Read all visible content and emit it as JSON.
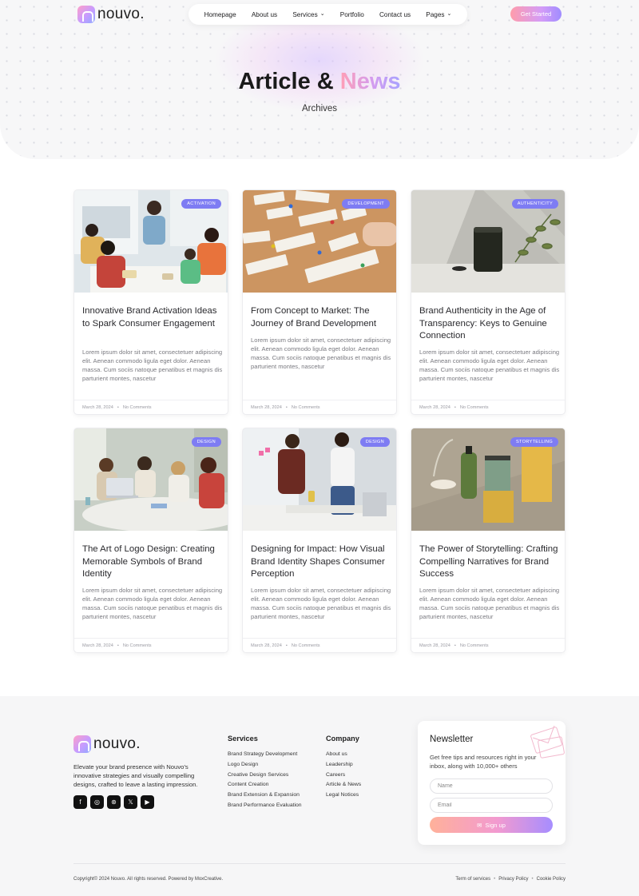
{
  "header": {
    "logo_text": "nouvo.",
    "nav": [
      {
        "label": "Homepage",
        "has_dropdown": false
      },
      {
        "label": "About us",
        "has_dropdown": false
      },
      {
        "label": "Services",
        "has_dropdown": true
      },
      {
        "label": "Portfolio",
        "has_dropdown": false
      },
      {
        "label": "Contact us",
        "has_dropdown": false
      },
      {
        "label": "Pages",
        "has_dropdown": true
      }
    ],
    "cta_label": "Get Started"
  },
  "hero": {
    "title_main": "Article & ",
    "title_accent": "News",
    "subtitle": "Archives"
  },
  "posts": [
    {
      "category": "ACTIVATION",
      "title": "Innovative Brand Activation Ideas to Spark Consumer Engagement",
      "excerpt": "Lorem ipsum dolor sit amet, consectetuer adipiscing elit. Aenean commodo ligula eget dolor. Aenean massa. Cum sociis natoque penatibus et magnis dis parturient montes, nascetur",
      "date": "March 28, 2024",
      "comments": "No Comments"
    },
    {
      "category": "DEVELOPMENT",
      "title": "From Concept to Market: The Journey of Brand Development",
      "excerpt": "Lorem ipsum dolor sit amet, consectetuer adipiscing elit. Aenean commodo ligula eget dolor. Aenean massa. Cum sociis natoque penatibus et magnis dis parturient montes, nascetur",
      "date": "March 28, 2024",
      "comments": "No Comments"
    },
    {
      "category": "AUTHENTICITY",
      "title": "Brand Authenticity in the Age of Transparency: Keys to Genuine Connection",
      "excerpt": "Lorem ipsum dolor sit amet, consectetuer adipiscing elit. Aenean commodo ligula eget dolor. Aenean massa. Cum sociis natoque penatibus et magnis dis parturient montes, nascetur",
      "date": "March 28, 2024",
      "comments": "No Comments"
    },
    {
      "category": "DESIGN",
      "title": "The Art of Logo Design: Creating Memorable Symbols of Brand Identity",
      "excerpt": "Lorem ipsum dolor sit amet, consectetuer adipiscing elit. Aenean commodo ligula eget dolor. Aenean massa. Cum sociis natoque penatibus et magnis dis parturient montes, nascetur",
      "date": "March 28, 2024",
      "comments": "No Comments"
    },
    {
      "category": "DESIGN",
      "title": "Designing for Impact: How Visual Brand Identity Shapes Consumer Perception",
      "excerpt": "Lorem ipsum dolor sit amet, consectetuer adipiscing elit. Aenean commodo ligula eget dolor. Aenean massa. Cum sociis natoque penatibus et magnis dis parturient montes, nascetur",
      "date": "March 28, 2024",
      "comments": "No Comments"
    },
    {
      "category": "STORYTELLING",
      "title": "The Power of Storytelling: Crafting Compelling Narratives for Brand Success",
      "excerpt": "Lorem ipsum dolor sit amet, consectetuer adipiscing elit. Aenean commodo ligula eget dolor. Aenean massa. Cum sociis natoque penatibus et magnis dis parturient montes, nascetur",
      "date": "March 28, 2024",
      "comments": "No Comments"
    }
  ],
  "footer": {
    "logo_text": "nouvo.",
    "description": "Elevate your brand presence with Nouvo's innovative strategies and visually compelling designs, crafted to leave a lasting impression.",
    "socials": [
      "facebook-icon",
      "instagram-icon",
      "dribbble-icon",
      "x-icon",
      "youtube-icon"
    ],
    "services_heading": "Services",
    "services": [
      "Brand Strategy Development",
      "Logo Design",
      "Creative Design Services",
      "Content Creation",
      "Brand Extension & Expansion",
      "Brand Performance Evaluation"
    ],
    "company_heading": "Company",
    "company": [
      "About us",
      "Leadership",
      "Careers",
      "Article & News",
      "Legal Notices"
    ],
    "newsletter": {
      "title": "Newsletter",
      "description": "Get free tips and resources right in your inbox, along with 10,000+ others",
      "name_placeholder": "Name",
      "email_placeholder": "Email",
      "button_label": "Sign up"
    },
    "copyright": "Copyright© 2024 Nouvo. All rights reserved. Powered by MoxCreative.",
    "legal": [
      "Term of services",
      "Privacy Policy",
      "Cookie Policy"
    ]
  },
  "colors": {
    "badge": "#7e7cf3",
    "accent_gradient_start": "#ff9fb6",
    "accent_gradient_end": "#a7a2ff"
  }
}
